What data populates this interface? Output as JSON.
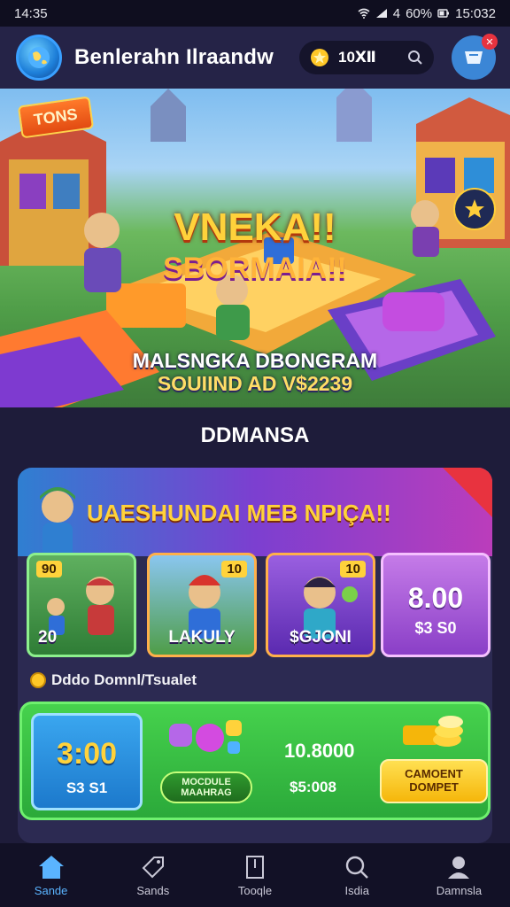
{
  "status_bar": {
    "time": "14:35",
    "signal": "4",
    "battery": "60%",
    "clock_right": "15:032"
  },
  "header": {
    "title": "Benlerahn Ilraandw",
    "coins": "10Ⅻ",
    "cart_badge": "✕"
  },
  "hero": {
    "tag": "TONS",
    "title_line1": "VNEKA!!",
    "title_line2": "SBORMAIA!!",
    "sub_line1": "MALSNGKA DBONGRAM",
    "sub_line2": "SOUIIND AD V$2239"
  },
  "section_title": "DDMANSA",
  "promo": {
    "headline": "UAESHUNDAI MEB NPIÇA!!",
    "tiles": [
      {
        "badge": "90",
        "caption": "20"
      },
      {
        "badge": "10",
        "caption": "LAKULY"
      },
      {
        "badge": "10",
        "caption": "$GJONI"
      },
      {
        "big": "8.00",
        "small": "$3 S0"
      }
    ],
    "wallet_label": "Dddo Domnl/Tsualet",
    "green_panel": {
      "price": "3:00",
      "price_sub": "S3 S1",
      "pill_line1": "MOCDULE",
      "pill_line2": "MAAHRAG",
      "value1": "10.8000",
      "value2": "$5:008",
      "button_line1": "CAMOENT",
      "button_line2": "DOMPET"
    }
  },
  "nav": [
    {
      "label": "Sande",
      "icon": "home-icon"
    },
    {
      "label": "Sands",
      "icon": "tag-icon"
    },
    {
      "label": "Tooqle",
      "icon": "bookmark-icon"
    },
    {
      "label": "Isdia",
      "icon": "search-icon"
    },
    {
      "label": "Damnsla",
      "icon": "user-icon"
    }
  ],
  "colors": {
    "accent": "#3b86d6",
    "gold": "#ffd23b",
    "green": "#2ba93a",
    "background": "#1e1c3a"
  }
}
